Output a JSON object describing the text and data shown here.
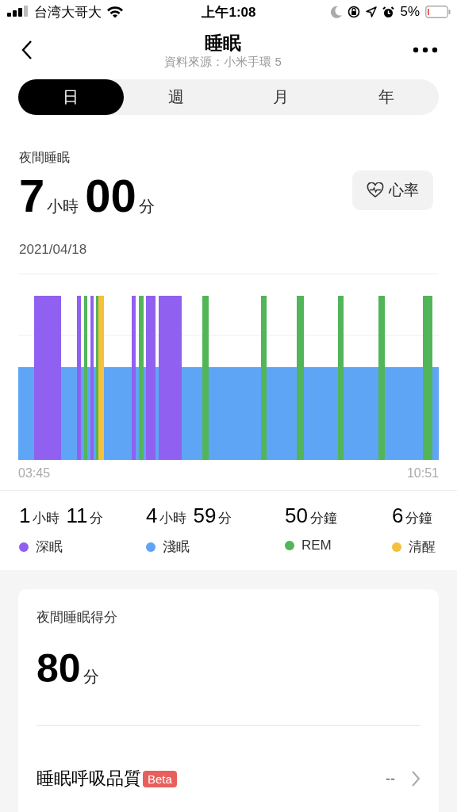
{
  "status_bar": {
    "carrier": "台湾大哥大",
    "time": "上午1:08",
    "battery": "5%"
  },
  "header": {
    "title": "睡眠",
    "subtitle": "資料來源：小米手環 5"
  },
  "tabs": [
    {
      "label": "日",
      "selected": true
    },
    {
      "label": "週",
      "selected": false
    },
    {
      "label": "月",
      "selected": false
    },
    {
      "label": "年",
      "selected": false
    }
  ],
  "summary": {
    "title": "夜間睡眠",
    "duration": [
      {
        "value": "7",
        "unit": "小時"
      },
      {
        "value": "00",
        "unit": "分"
      }
    ],
    "date": "2021/04/18",
    "heart_button": "心率"
  },
  "hypnogram": {
    "start": "03:45",
    "end": "10:51"
  },
  "stages": [
    {
      "name": "深眠",
      "color": "#9061f0",
      "duration": [
        {
          "value": "1",
          "unit": "小時"
        },
        {
          "value": "11",
          "unit": "分"
        }
      ]
    },
    {
      "name": "淺眠",
      "color": "#5fa5f5",
      "duration": [
        {
          "value": "4",
          "unit": "小時"
        },
        {
          "value": "59",
          "unit": "分"
        }
      ]
    },
    {
      "name": "REM",
      "color": "#52b55a",
      "duration": [
        {
          "value": "50",
          "unit": "分鐘"
        }
      ]
    },
    {
      "name": "清醒",
      "color": "#f5c03a",
      "duration": [
        {
          "value": "6",
          "unit": "分鐘"
        }
      ]
    }
  ],
  "score_card": {
    "title": "夜間睡眠得分",
    "score": "80",
    "unit": "分",
    "row": {
      "label": "睡眠呼吸品質",
      "badge": "Beta",
      "value": "--"
    }
  }
}
